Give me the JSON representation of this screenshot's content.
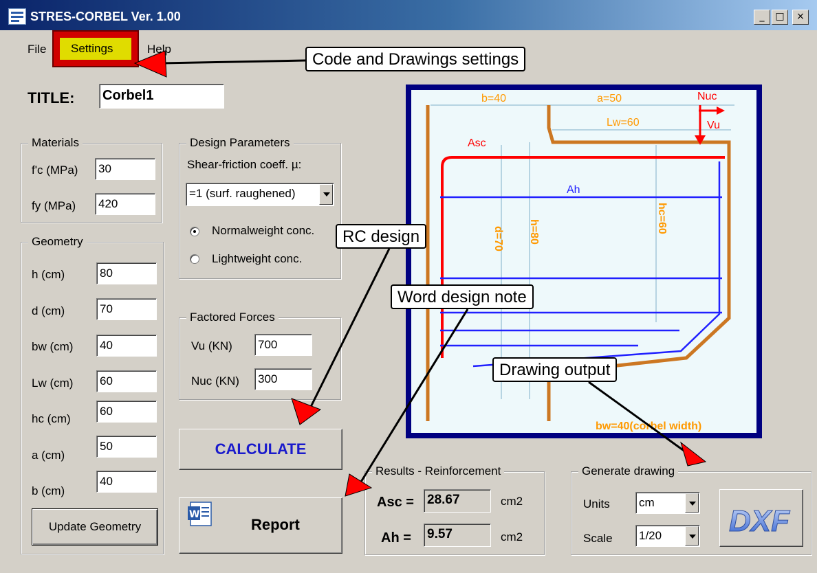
{
  "window": {
    "title": "STRES-CORBEL Ver. 1.00",
    "min_glyph": "_",
    "max_glyph": "□",
    "close_glyph": "×"
  },
  "menu": {
    "file": "File",
    "settings": "Settings",
    "help": "Help"
  },
  "callouts": {
    "settings": "Code and Drawings settings",
    "rc_design": "RC design",
    "word_note": "Word design note",
    "drawing_output": "Drawing output"
  },
  "title_field": {
    "label": "TITLE:",
    "value": "Corbel1"
  },
  "materials": {
    "title": "Materials",
    "fc_label": "f'c (MPa)",
    "fc_value": "30",
    "fy_label": "fy (MPa)",
    "fy_value": "420"
  },
  "geometry": {
    "title": "Geometry",
    "h_label": "h (cm)",
    "h_value": "80",
    "d_label": "d (cm)",
    "d_value": "70",
    "bw_label": "bw (cm)",
    "bw_value": "40",
    "lw_label": "Lw (cm)",
    "lw_value": "60",
    "hc_label": "hc (cm)",
    "hc_value": "60",
    "a_label": "a (cm)",
    "a_value": "50",
    "b_label": "b (cm)",
    "b_value": "40",
    "update_button": "Update Geometry"
  },
  "design_params": {
    "title": "Design Parameters",
    "mu_label": "Shear-friction coeff. µ:",
    "mu_value": "=1 (surf. raughened)",
    "normal_label": "Normalweight conc.",
    "light_label": "Lightweight conc."
  },
  "forces": {
    "title": "Factored Forces",
    "vu_label": "Vu (KN)",
    "vu_value": "700",
    "nuc_label": "Nuc (KN)",
    "nuc_value": "300"
  },
  "buttons": {
    "calculate": "CALCULATE",
    "report": "Report",
    "dxf": "DXF"
  },
  "results": {
    "title": "Results - Reinforcement",
    "asc_label": "Asc =",
    "asc_value": "28.67",
    "asc_unit": "cm2",
    "ah_label": "Ah =",
    "ah_value": "9.57",
    "ah_unit": "cm2"
  },
  "generate": {
    "title": "Generate drawing",
    "units_label": "Units",
    "units_value": "cm",
    "scale_label": "Scale",
    "scale_value": "1/20"
  },
  "drawing": {
    "b": "b=40",
    "a": "a=50",
    "lw": "Lw=60",
    "nuc": "Nuc",
    "vu": "Vu",
    "asc": "Asc",
    "ah": "Ah",
    "d": "d=70",
    "h": "h=80",
    "hc": "hc=60",
    "bw": "bw=40(corbel width)"
  },
  "colors": {
    "frame": "#000080",
    "concrete": "#cc7722",
    "rebar_asc": "#ff0000",
    "rebar_ah": "#0000ff",
    "dim_text": "#ff9900",
    "callout_arrow": "#ff0000",
    "calculate_text": "#1a1acc"
  }
}
